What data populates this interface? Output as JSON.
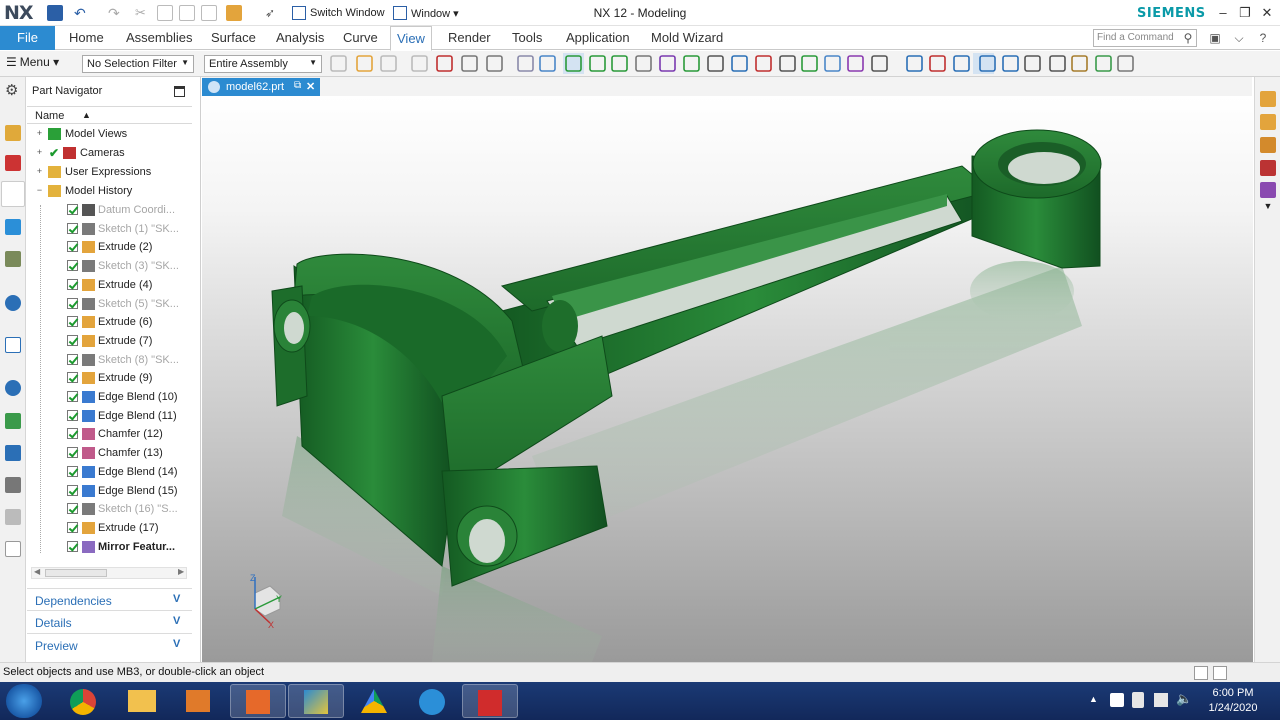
{
  "titlebar": {
    "logo": "NX",
    "switch_window": "Switch Window",
    "window_menu": "Window ▾",
    "app_title": "NX 12 - Modeling",
    "brand": "SIEMENS"
  },
  "ribbon": {
    "file": "File",
    "tabs": [
      "Home",
      "Assemblies",
      "Surface",
      "Analysis",
      "Curve",
      "View",
      "Render",
      "Tools",
      "Application",
      "Mold Wizard"
    ],
    "active_tab": "View",
    "find_placeholder": "Find a Command"
  },
  "toolbar": {
    "menu": "Menu ▾",
    "selection_filter": "No Selection Filter",
    "assembly_scope": "Entire Assembly"
  },
  "navigator": {
    "title": "Part Navigator",
    "column": "Name",
    "top_items": [
      {
        "label": "Model Views"
      },
      {
        "label": "Cameras"
      },
      {
        "label": "User Expressions"
      },
      {
        "label": "Model History"
      }
    ],
    "history": [
      {
        "label": "Datum Coordi...",
        "state": "dim"
      },
      {
        "label": "Sketch (1) \"SK...",
        "state": "dim"
      },
      {
        "label": "Extrude (2)",
        "state": "normal"
      },
      {
        "label": "Sketch (3) \"SK...",
        "state": "dim"
      },
      {
        "label": "Extrude (4)",
        "state": "normal"
      },
      {
        "label": "Sketch (5) \"SK...",
        "state": "dim"
      },
      {
        "label": "Extrude (6)",
        "state": "normal"
      },
      {
        "label": "Extrude (7)",
        "state": "normal"
      },
      {
        "label": "Sketch (8) \"SK...",
        "state": "dim"
      },
      {
        "label": "Extrude (9)",
        "state": "normal"
      },
      {
        "label": "Edge Blend (10)",
        "state": "normal"
      },
      {
        "label": "Edge Blend (11)",
        "state": "normal"
      },
      {
        "label": "Chamfer (12)",
        "state": "normal"
      },
      {
        "label": "Chamfer (13)",
        "state": "normal"
      },
      {
        "label": "Edge Blend (14)",
        "state": "normal"
      },
      {
        "label": "Edge Blend (15)",
        "state": "normal"
      },
      {
        "label": "Sketch (16) \"S...",
        "state": "dim"
      },
      {
        "label": "Extrude (17)",
        "state": "normal"
      },
      {
        "label": "Mirror Featur...",
        "state": "bold"
      }
    ],
    "panels": [
      "Dependencies",
      "Details",
      "Preview"
    ]
  },
  "document": {
    "tab": "model62.prt"
  },
  "triad": {
    "x": "X",
    "y": "Y",
    "z": "Z"
  },
  "status": "Select objects and use MB3, or double-click an object",
  "clock": {
    "time": "6:00 PM",
    "date": "1/24/2020"
  }
}
